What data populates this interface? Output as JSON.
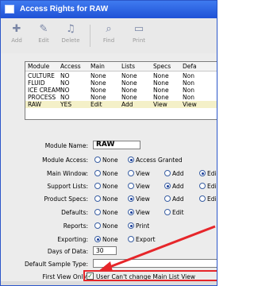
{
  "window": {
    "title": "Access Rights for RAW"
  },
  "toolbar": {
    "buttons": [
      {
        "label": "Add"
      },
      {
        "label": "Edit"
      },
      {
        "label": "Delete"
      },
      {
        "label": "Find"
      },
      {
        "label": "Print"
      }
    ]
  },
  "grid": {
    "columns": [
      "Module",
      "Access",
      "Main",
      "Lists",
      "Specs",
      "Defa"
    ],
    "rows": [
      [
        "CULTURE",
        "NO",
        "None",
        "None",
        "None",
        "Non"
      ],
      [
        "FLUID",
        "NO",
        "None",
        "None",
        "None",
        "Non"
      ],
      [
        "ICE CREAM",
        "NO",
        "None",
        "None",
        "None",
        "Non"
      ],
      [
        "PROCESS",
        "NO",
        "None",
        "None",
        "None",
        "Non"
      ],
      [
        "RAW",
        "YES",
        "Edit",
        "Add",
        "View",
        "View"
      ]
    ]
  },
  "form": {
    "module_name": {
      "label": "Module Name:",
      "value": "RAW"
    },
    "module_access": {
      "label": "Module Access:",
      "opt1": "None",
      "opt2": "Access Granted"
    },
    "main_window": {
      "label": "Main Window:",
      "opt1": "None",
      "opt2": "View",
      "opt3": "Add",
      "opt4": "Edi"
    },
    "support_lists": {
      "label": "Support Lists:",
      "opt1": "None",
      "opt2": "View",
      "opt3": "Add",
      "opt4": "Edi"
    },
    "product_specs": {
      "label": "Product Specs:",
      "opt1": "None",
      "opt2": "View",
      "opt3": "Add",
      "opt4": "Edi"
    },
    "defaults": {
      "label": "Defaults:",
      "opt1": "None",
      "opt2": "View",
      "opt3": "Edit"
    },
    "reports": {
      "label": "Reports:",
      "opt1": "None",
      "opt2": "Print"
    },
    "exporting": {
      "label": "Exporting:",
      "opt1": "None",
      "opt2": "Export"
    },
    "days_of_data": {
      "label": "Days of Data:",
      "value": "30"
    },
    "default_sample_type": {
      "label": "Default Sample Type:",
      "value": ""
    },
    "first_view_only": {
      "label": "First View Only:",
      "checkbox_label": "User Can't change Main List View"
    }
  },
  "colors": {
    "titlebar": "#2a5fe0",
    "highlight": "#e6262a",
    "selected_row": "#f4f0c8"
  }
}
